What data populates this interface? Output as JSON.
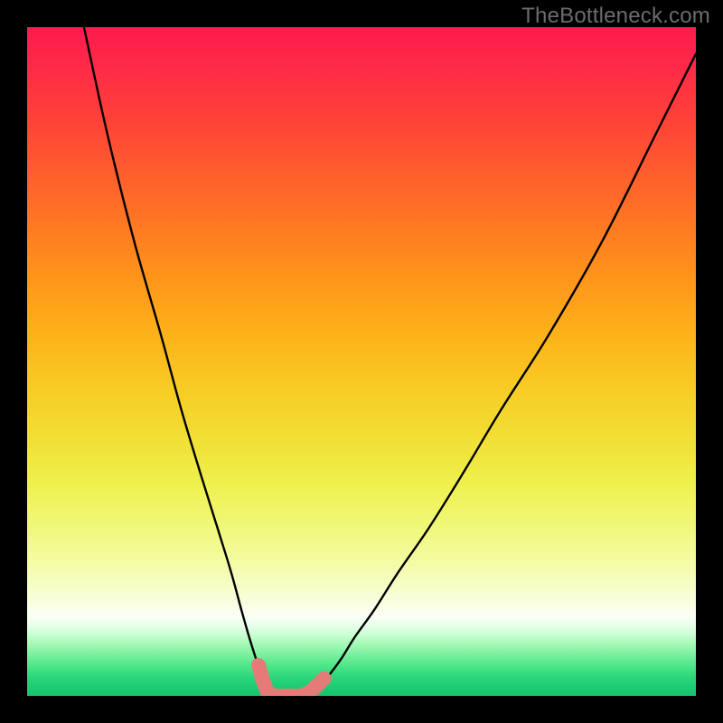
{
  "watermark": "TheBottleneck.com",
  "colors": {
    "background": "#000000",
    "curve": "#000000",
    "marker_fill": "#e57a78",
    "marker_stroke": "#d86a68"
  },
  "chart_data": {
    "type": "line",
    "title": "",
    "xlabel": "",
    "ylabel": "",
    "xlim": [
      0,
      100
    ],
    "ylim": [
      0,
      100
    ],
    "series": [
      {
        "name": "left-curve",
        "x": [
          8.5,
          12,
          16,
          20,
          23,
          26,
          28.5,
          30.5,
          32,
          33.2,
          34.2,
          35,
          35.6,
          36.1,
          36.5
        ],
        "y": [
          100,
          84,
          68,
          54,
          43,
          33,
          25,
          18.5,
          13,
          8.8,
          5.6,
          3.3,
          1.8,
          0.9,
          0.4
        ]
      },
      {
        "name": "right-curve",
        "x": [
          42.3,
          43,
          44,
          45.3,
          47,
          49,
          52,
          55.5,
          60,
          65,
          71,
          78,
          86,
          94,
          100
        ],
        "y": [
          0.4,
          0.9,
          1.8,
          3.3,
          5.6,
          8.8,
          13,
          18.5,
          25,
          33,
          43,
          54,
          68,
          84,
          96
        ]
      }
    ],
    "markers": {
      "name": "bottleneck-points",
      "color": "#e57a78",
      "points": [
        {
          "x": 34.6,
          "y": 4.6,
          "r": 5
        },
        {
          "x": 35.2,
          "y": 2.5,
          "r": 8
        },
        {
          "x": 35.9,
          "y": 0.6,
          "r": 8
        },
        {
          "x": 36.9,
          "y": 0.0,
          "r": 8
        },
        {
          "x": 38.3,
          "y": 0.0,
          "r": 8
        },
        {
          "x": 39.6,
          "y": 0.0,
          "r": 8
        },
        {
          "x": 40.9,
          "y": 0.0,
          "r": 8
        },
        {
          "x": 42.0,
          "y": 0.4,
          "r": 8
        },
        {
          "x": 42.9,
          "y": 1.1,
          "r": 5
        },
        {
          "x": 44.4,
          "y": 2.6,
          "r": 5
        }
      ]
    }
  }
}
